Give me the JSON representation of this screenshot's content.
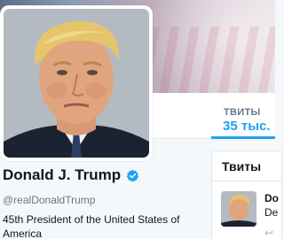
{
  "profile": {
    "name": "Donald J. Trump",
    "handle": "@realDonaldTrump",
    "bio": "45th President of the United States of America",
    "verified": true
  },
  "stats": {
    "tweets_label": "ТВИТЫ",
    "tweets_value": "35 тыс."
  },
  "tweets_panel": {
    "title": "Твиты",
    "first_tweet": {
      "name_fragment": "Do",
      "handle_fragment": "De",
      "reply_icon": "reply-icon"
    }
  },
  "colors": {
    "accent": "#1da1f2",
    "text_primary": "#14171a",
    "text_secondary": "#657786"
  }
}
